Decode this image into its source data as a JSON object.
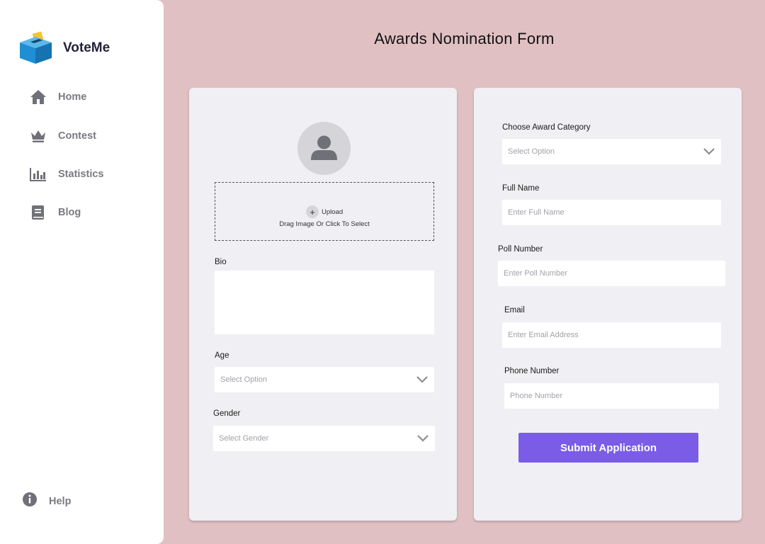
{
  "app": {
    "name": "VoteMe"
  },
  "sidebar": {
    "items": [
      {
        "label": "Home",
        "icon": "home-icon"
      },
      {
        "label": "Contest",
        "icon": "crown-icon"
      },
      {
        "label": "Statistics",
        "icon": "bar-chart-icon"
      },
      {
        "label": "Blog",
        "icon": "book-icon"
      }
    ],
    "help": {
      "label": "Help",
      "icon": "info-icon"
    }
  },
  "page": {
    "title": "Awards Nomination Form"
  },
  "left_card": {
    "upload": {
      "button_label": "Upload",
      "hint": "Drag Image Or Click To Select"
    },
    "bio": {
      "label": "Bio"
    },
    "age": {
      "label": "Age",
      "placeholder": "Select Option"
    },
    "gender": {
      "label": "Gender",
      "placeholder": "Select Gender"
    }
  },
  "right_card": {
    "category": {
      "label": "Choose Award Category",
      "placeholder": "Select Option"
    },
    "full_name": {
      "label": "Full Name",
      "placeholder": "Enter Full Name"
    },
    "poll_number": {
      "label": "Poll Number",
      "placeholder": "Enter Poll Number"
    },
    "email": {
      "label": "Email",
      "placeholder": "Enter Email Address"
    },
    "phone": {
      "label": "Phone Number",
      "placeholder": "Phone Number"
    },
    "submit_label": "Submit Application"
  },
  "colors": {
    "background": "#e0c0c2",
    "card": "#f0f0f4",
    "accent": "#7b5ce6",
    "logo_box": "#1e8fd4",
    "logo_ballot": "#f5c431"
  }
}
